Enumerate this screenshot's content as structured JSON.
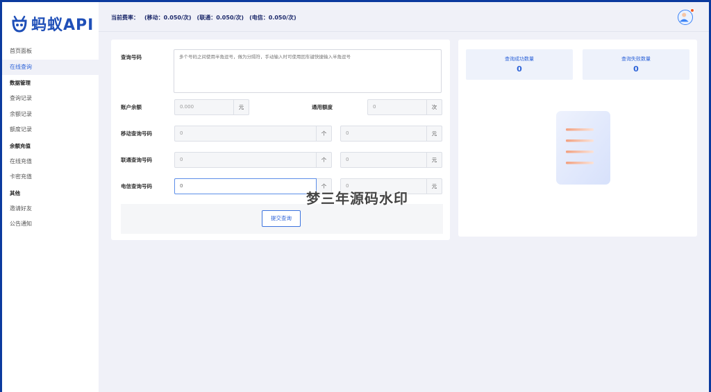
{
  "app": {
    "logo_text": "蚂蚁API"
  },
  "header": {
    "rate_label": "当前费率：",
    "rates": [
      "(移动：0.050/次)",
      "(联通：0.050/次)",
      "(电信：0.050/次)"
    ]
  },
  "sidebar": {
    "items": [
      {
        "label": "首页面板",
        "type": "item"
      },
      {
        "label": "在线查询",
        "type": "item",
        "active": true
      },
      {
        "label": "数据管理",
        "type": "group"
      },
      {
        "label": "查询记录",
        "type": "item"
      },
      {
        "label": "余额记录",
        "type": "item"
      },
      {
        "label": "额度记录",
        "type": "item"
      },
      {
        "label": "余额充值",
        "type": "group"
      },
      {
        "label": "在线充值",
        "type": "item"
      },
      {
        "label": "卡密充值",
        "type": "item"
      },
      {
        "label": "其他",
        "type": "group"
      },
      {
        "label": "邀请好友",
        "type": "item"
      },
      {
        "label": "公告通知",
        "type": "item"
      }
    ]
  },
  "form": {
    "query_number_label": "查询号码",
    "query_number_placeholder": "多个号码之间使用半角逗号，做为分隔符，手动输入时可使用回车键快捷输入半角逗号",
    "balance_label": "账户余额",
    "balance_value": "0.000",
    "balance_unit": "元",
    "quota_label": "通用额度",
    "quota_value": "0",
    "quota_unit": "次",
    "mobile_label": "移动查询号码",
    "mobile_count": "0",
    "mobile_count_unit": "个",
    "mobile_cost": "0",
    "mobile_cost_unit": "元",
    "unicom_label": "联通查询号码",
    "unicom_count": "0",
    "unicom_count_unit": "个",
    "unicom_cost": "0",
    "unicom_cost_unit": "元",
    "telecom_label": "电信查询号码",
    "telecom_count": "0",
    "telecom_count_unit": "个",
    "telecom_cost": "0",
    "telecom_cost_unit": "元",
    "submit_label": "提交查询"
  },
  "stats": {
    "success_label": "查询成功数量",
    "success_value": "0",
    "fail_label": "查询失败数量",
    "fail_value": "0"
  },
  "watermark": "梦三年源码水印",
  "colors": {
    "brand": "#1f4fb8",
    "accent": "#2d63d8",
    "frame": "#0b3a9e"
  }
}
